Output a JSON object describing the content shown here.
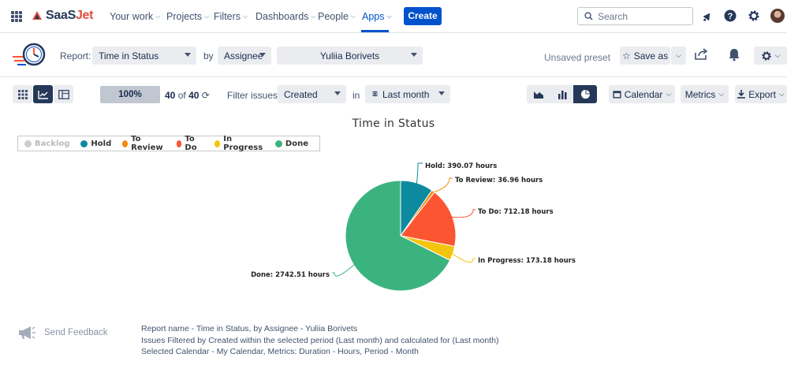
{
  "nav": {
    "logo": {
      "brand_a": "SaaS",
      "brand_b": "Jet"
    },
    "items": [
      {
        "label": "Your work"
      },
      {
        "label": "Projects"
      },
      {
        "label": "Filters"
      },
      {
        "label": "Dashboards"
      },
      {
        "label": "People"
      },
      {
        "label": "Apps"
      }
    ],
    "active": "Apps",
    "create_label": "Create",
    "search_placeholder": "Search"
  },
  "report": {
    "report_label": "Report:",
    "report_value": "Time in Status",
    "by_label": "by",
    "group_value": "Assignee",
    "user_value": "Yuliia Borivets",
    "unsaved_label": "Unsaved preset",
    "save_as_label": "Save as"
  },
  "filter": {
    "progress": "100%",
    "count_done": "40",
    "count_of": "of",
    "count_total": "40",
    "filter_label": "Filter issues:",
    "filter_value": "Created",
    "in_label": "in",
    "period_value": "Last month",
    "calendar_label": "Calendar",
    "metrics_label": "Metrics",
    "export_label": "Export"
  },
  "colors": {
    "accent": "#0052cc",
    "backlog": "#cccccc",
    "hold": "#0e8aa0",
    "to_review": "#f58a07",
    "to_do": "#fc5531",
    "in_progress": "#f5c40f",
    "done": "#3bb37f"
  },
  "chart_data": {
    "type": "pie",
    "title": "Time in Status",
    "legend_position": "top-left",
    "legend": [
      {
        "name": "Backlog",
        "color": "#cccccc",
        "hidden": true
      },
      {
        "name": "Hold",
        "color": "#0e8aa0"
      },
      {
        "name": "To Review",
        "color": "#f58a07"
      },
      {
        "name": "To Do",
        "color": "#fc5531"
      },
      {
        "name": "In Progress",
        "color": "#f5c40f"
      },
      {
        "name": "Done",
        "color": "#3bb37f"
      }
    ],
    "slices": [
      {
        "name": "Hold",
        "value": 390.07,
        "label": "Hold: 390.07 hours",
        "color": "#0e8aa0"
      },
      {
        "name": "To Review",
        "value": 36.96,
        "label": "To Review: 36.96 hours",
        "color": "#f58a07"
      },
      {
        "name": "To Do",
        "value": 712.18,
        "label": "To Do: 712.18 hours",
        "color": "#fc5531"
      },
      {
        "name": "In Progress",
        "value": 173.18,
        "label": "In Progress: 173.18 hours",
        "color": "#f5c40f"
      },
      {
        "name": "Done",
        "value": 2742.51,
        "label": "Done: 2742.51 hours",
        "color": "#3bb37f"
      }
    ],
    "units": "hours"
  },
  "footer": {
    "feedback_label": "Send Feedback",
    "line1": "Report name - Time in Status, by Assignee - Yuliia Borivets",
    "line2": "Issues Filtered by Created within the selected period (Last month) and calculated for (Last month)",
    "line3": "Selected Calendar - My Calendar, Metrics: Duration - Hours, Period - Month"
  }
}
